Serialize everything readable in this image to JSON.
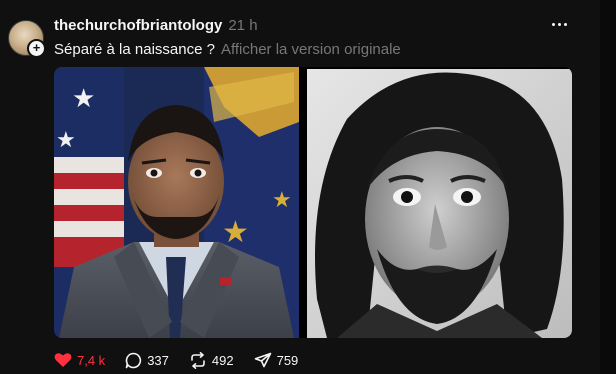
{
  "post": {
    "username": "thechurchofbriantology",
    "time": "21 h",
    "caption": "Séparé à la naissance ?",
    "translate_link": "Afficher la version originale"
  },
  "avatar": {
    "follow_glyph": "+"
  },
  "media": {
    "left_photo": "man in suit and tie in front of flags",
    "right_photo": "black-and-white mugshot of a man with long hair"
  },
  "actions": {
    "likes": "7,4 k",
    "comments": "337",
    "reposts": "492",
    "shares": "759"
  },
  "colors": {
    "background": "#101010",
    "text": "#f3f5f7",
    "muted": "#777777",
    "like": "#ff3040"
  },
  "icons": [
    "more-icon",
    "heart-icon",
    "comment-icon",
    "repost-icon",
    "share-icon",
    "follow-plus-icon"
  ]
}
